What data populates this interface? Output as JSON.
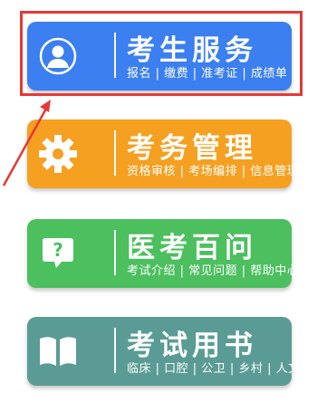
{
  "cards": [
    {
      "title": "考生服务",
      "subtitle": "报名 | 缴费 | 准考证 | 成绩单",
      "color": "#3b7ff0",
      "icon": "user-avatar-icon"
    },
    {
      "title": "考务管理",
      "subtitle": "资格审核 | 考场编排 | 信息管理",
      "color": "#f5a021",
      "icon": "gear-icon"
    },
    {
      "title": "医考百问",
      "subtitle": "考试介绍 | 常见问题 | 帮助中心",
      "color": "#4cbf5f",
      "icon": "question-chat-icon"
    },
    {
      "title": "考试用书",
      "subtitle": "临床 | 口腔 | 公卫 | 乡村 | 人文",
      "color": "#5a9c95",
      "icon": "open-book-icon"
    }
  ],
  "annotation_color": "#e53935"
}
